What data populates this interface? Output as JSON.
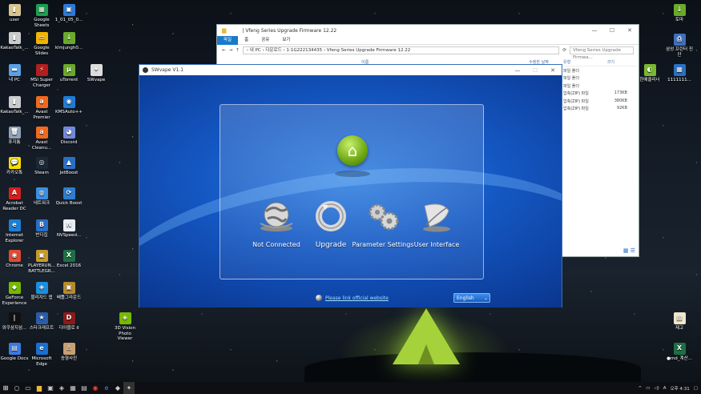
{
  "desktop": {
    "icons": [
      {
        "label": "user",
        "color": "#d9c48f",
        "glyph": "▮"
      },
      {
        "label": "Google Sheets",
        "color": "#1e9e50",
        "glyph": "▦"
      },
      {
        "label": "1_01_05_0...",
        "color": "#2c7ad6",
        "glyph": "▣"
      },
      {
        "label": "KakaoTalk_...",
        "color": "#cccccc",
        "glyph": "▮"
      },
      {
        "label": "Google Slides",
        "color": "#f2b300",
        "glyph": "▭"
      },
      {
        "label": "klmjungh0...",
        "color": "#6aaa2a",
        "glyph": "↓"
      },
      {
        "label": "내 PC",
        "color": "#5aa0e6",
        "glyph": "▬"
      },
      {
        "label": "MSI Super Charger",
        "color": "#b41e1e",
        "glyph": "⚡"
      },
      {
        "label": "uTorrent",
        "color": "#6aaa2a",
        "glyph": "µ"
      },
      {
        "label": "SWvape",
        "color": "#dddddd",
        "glyph": "✦"
      },
      {
        "label": "KakaoTalk_...",
        "color": "#cccccc",
        "glyph": "▮"
      },
      {
        "label": "Avast Premier",
        "color": "#f06a1e",
        "glyph": "a"
      },
      {
        "label": "KMSAuto++",
        "color": "#1f7bd6",
        "glyph": "◉"
      },
      {
        "label": "휴지통",
        "color": "#8fa3b8",
        "glyph": "🗑"
      },
      {
        "label": "Avast Cleanu...",
        "color": "#f06a1e",
        "glyph": "a"
      },
      {
        "label": "Discord",
        "color": "#7289da",
        "glyph": "◕"
      },
      {
        "label": "카카오톡",
        "color": "#f9e000",
        "glyph": "💬"
      },
      {
        "label": "Steam",
        "color": "#1b2838",
        "glyph": "◎"
      },
      {
        "label": "JetBoost",
        "color": "#2b6fc4",
        "glyph": "▲"
      },
      {
        "label": "Acrobat Reader DC",
        "color": "#d71e1e",
        "glyph": "A"
      },
      {
        "label": "네트워크",
        "color": "#3d8fe0",
        "glyph": "◍"
      },
      {
        "label": "Quick Boost",
        "color": "#2e7dd0",
        "glyph": "⟳"
      },
      {
        "label": "Internet Explorer",
        "color": "#1c7fd7",
        "glyph": "e"
      },
      {
        "label": "반디집",
        "color": "#2a6ec8",
        "glyph": "B"
      },
      {
        "label": "NVSpeed...",
        "color": "#e8eef4",
        "glyph": "N"
      },
      {
        "label": "Chrome",
        "color": "#e04a32",
        "glyph": "◉"
      },
      {
        "label": "PLAYERUN... BATTLEGR...",
        "color": "#c89a2a",
        "glyph": "▣"
      },
      {
        "label": "Excel 2016",
        "color": "#1d7044",
        "glyph": "X"
      },
      {
        "label": "GeForce Experience",
        "color": "#76b900",
        "glyph": "◆"
      },
      {
        "label": "블리자드 앱",
        "color": "#1a8fe0",
        "glyph": "◈"
      },
      {
        "label": "배틀그라운드",
        "color": "#b88a2a",
        "glyph": "▣"
      },
      {
        "label": "와쿠삼지삼...",
        "color": "#111111",
        "glyph": "|"
      },
      {
        "label": "스타크래프트",
        "color": "#2a5ca8",
        "glyph": "★"
      },
      {
        "label": "디아블로 II",
        "color": "#8b1a1a",
        "glyph": "D"
      },
      {
        "label": "3D Vision Photo Viewer",
        "color": "#76b900",
        "glyph": "◈"
      },
      {
        "label": "Google Docs",
        "color": "#3a7ae6",
        "glyph": "▤"
      },
      {
        "label": "Microsoft Edge",
        "color": "#1a6fd0",
        "glyph": "e"
      },
      {
        "label": "송형사진",
        "color": "#c8a070",
        "glyph": "♙"
      },
      {
        "label": "토마",
        "color": "#6aaa2a",
        "glyph": "↓"
      },
      {
        "label": "삼성 프린터 진단",
        "color": "#3d6fbf",
        "glyph": "⎙"
      },
      {
        "label": "한예클리너",
        "color": "#7ab830",
        "glyph": "◐"
      },
      {
        "label": "1111111...",
        "color": "#2b6fc4",
        "glyph": "▦"
      },
      {
        "label": "제고",
        "color": "#f0e6c8",
        "glyph": "▤"
      },
      {
        "label": "●md_계산...",
        "color": "#1d7044",
        "glyph": "X"
      }
    ]
  },
  "explorer": {
    "title": "| Vfeng Series Upgrade Firmware 12.22",
    "ribbon": [
      "파일",
      "홈",
      "공유",
      "보기"
    ],
    "path": "› 내 PC › 다운로드 › 1-1G222134435 › Vfeng Series Upgrade Firmware 12.22",
    "search_placeholder": "Vfeng Series Upgrade Firmwa...",
    "col_name": "이름",
    "col_date": "수정한 날짜",
    "col_type": "유형",
    "col_size": "크기",
    "rows": [
      {
        "type": "파일 폴더",
        "size": ""
      },
      {
        "type": "파일 폴더",
        "size": ""
      },
      {
        "type": "파일 폴더",
        "size": ""
      },
      {
        "type": "압축(ZIP) 파일",
        "size": "173KB"
      },
      {
        "type": "압축(ZIP) 파일",
        "size": "380KB"
      },
      {
        "type": "압축(ZIP) 파일",
        "size": "92KB"
      }
    ],
    "minimize": "—",
    "maximize": "☐",
    "close": "✕"
  },
  "swvape": {
    "title": "SWvape V1.1",
    "features": [
      {
        "label": "Not Connected",
        "icon": "globe-icon"
      },
      {
        "label": "Upgrade",
        "icon": "upgrade-icon"
      },
      {
        "label": "Parameter Settings",
        "icon": "gears-icon"
      },
      {
        "label": "User Interface",
        "icon": "feather-icon"
      }
    ],
    "link": "Please link official website",
    "language": "English",
    "accent": "#1457c2",
    "home_color": "#6da713"
  },
  "taskbar": {
    "time": "오후 4:31",
    "lang": "A"
  }
}
